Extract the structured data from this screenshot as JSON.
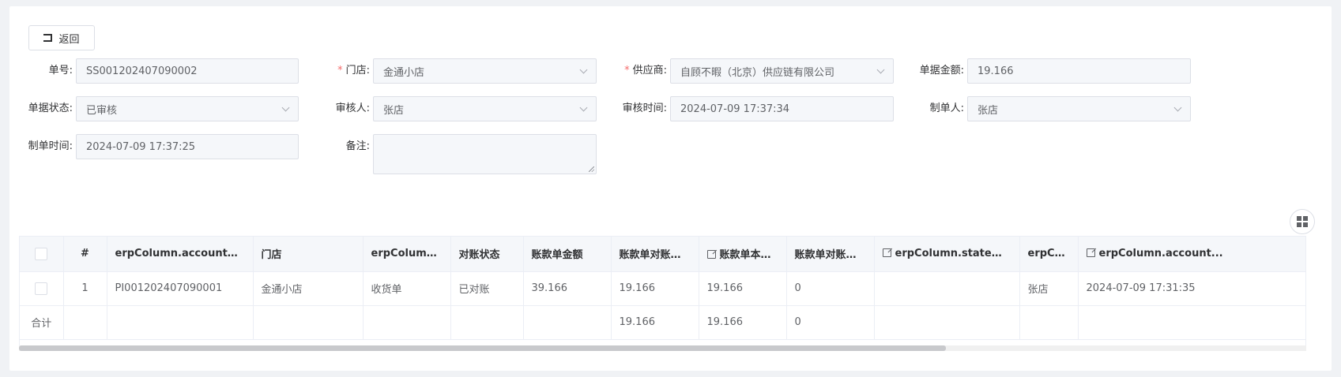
{
  "header": {
    "back_label": "返回"
  },
  "form": {
    "order_no_label": "单号:",
    "order_no_value": "SS001202407090002",
    "store_label": "门店:",
    "store_value": "金通小店",
    "supplier_label": "供应商:",
    "supplier_value": "自顾不暇（北京）供应链有限公司",
    "amount_label": "单据金额:",
    "amount_value": "19.166",
    "status_label": "单据状态:",
    "status_value": "已审核",
    "reviewer_label": "审核人:",
    "reviewer_value": "张店",
    "review_time_label": "审核时间:",
    "review_time_value": "2024-07-09 17:37:34",
    "creator_label": "制单人:",
    "creator_value": "张店",
    "create_time_label": "制单时间:",
    "create_time_value": "2024-07-09 17:37:25",
    "remark_label": "备注:",
    "remark_value": ""
  },
  "table": {
    "headers": [
      "#",
      "erpColumn.accountSheetNo",
      "门店",
      "erpColumn.ac...",
      "对账状态",
      "账款单金额",
      "账款单对账前...",
      "账款单本期...",
      "账款单对账后...",
      "erpColumn.statementM...",
      "erpCol...",
      "erpColumn.account..."
    ],
    "rows": [
      [
        "1",
        "PI001202407090001",
        "金通小店",
        "收货单",
        "已对账",
        "39.166",
        "19.166",
        "19.166",
        "0",
        "",
        "张店",
        "2024-07-09 17:31:35"
      ]
    ],
    "footer": [
      "合计",
      "",
      "",
      "",
      "",
      "",
      "",
      "19.166",
      "19.166",
      "0",
      "",
      "",
      ""
    ]
  },
  "scrollbar": {
    "position_fraction": 0.0,
    "visible_fraction": 0.72
  },
  "colors": {
    "required": "#f56c6c",
    "border": "#dcdfe6",
    "header_bg": "#f5f7fa"
  },
  "icons": {
    "back": "back-icon",
    "chevron": "chevron-down-icon",
    "edit": "edit-icon",
    "grid": "grid-layout-icon"
  }
}
